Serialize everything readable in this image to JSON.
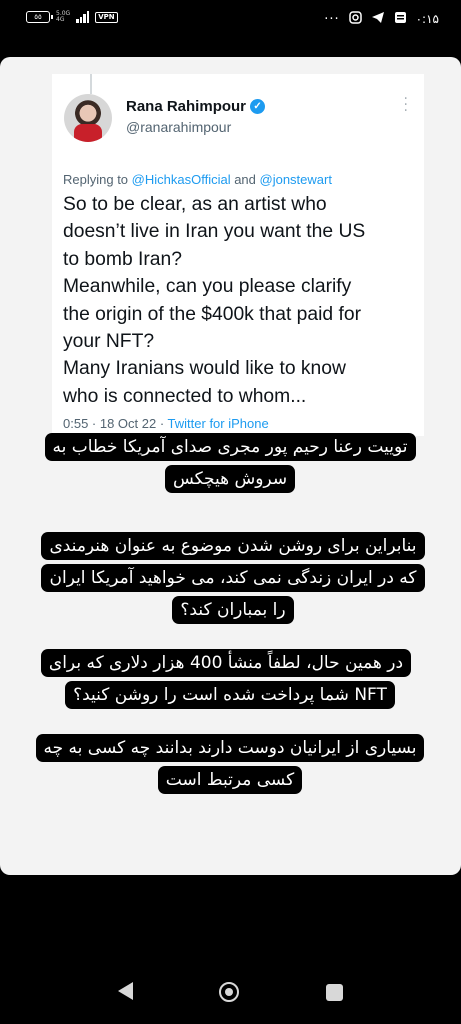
{
  "status_bar": {
    "battery": "٥٥",
    "network_type": "5.0G",
    "network_sub": "4G",
    "vpn": "VPN",
    "time": "۰:۱۵",
    "icons": [
      "more-dots-icon",
      "instagram-icon",
      "telegram-icon",
      "notification-icon"
    ]
  },
  "tweet": {
    "name": "Rana Rahimpour",
    "handle": "@ranarahimpour",
    "replying_prefix": "Replying to ",
    "reply_user_1": "@HichkasOfficial",
    "reply_and": " and ",
    "reply_user_2": "@jonstewart",
    "lines": [
      "So to be clear, as an artist who",
      "doesn’t live in Iran you want the US",
      "to bomb Iran?",
      "Meanwhile, can you please clarify",
      "the origin of the $400k that paid for",
      "your NFT?",
      "Many Iranians would like to know",
      "who is connected to whom..."
    ],
    "meta_time": "0:55 · 18 Oct 22 · ",
    "meta_source": "Twitter for iPhone"
  },
  "captions": [
    "توییت رعنا رحیم پور مجری صدای آمریکا خطاب به سروش هیچکس",
    "بنابراین برای روشن شدن موضوع به عنوان هنرمندی که در ایران زندگی نمی کند، می خواهید آمریکا ایران را بمباران کند؟",
    "در همین حال، لطفاً منشأ 400 هزار دلاری که برای NFT شما پرداخت شده است را روشن کنید؟",
    "بسیاری از ایرانیان دوست دارند بدانند چه کسی به چه کسی مرتبط است"
  ],
  "nav": {
    "back": "back-icon",
    "home": "home-icon",
    "recents": "recents-icon"
  },
  "colors": {
    "link_blue": "#1d9bf0",
    "card_bg": "#f3f3f3",
    "caption_bg": "#000000"
  }
}
